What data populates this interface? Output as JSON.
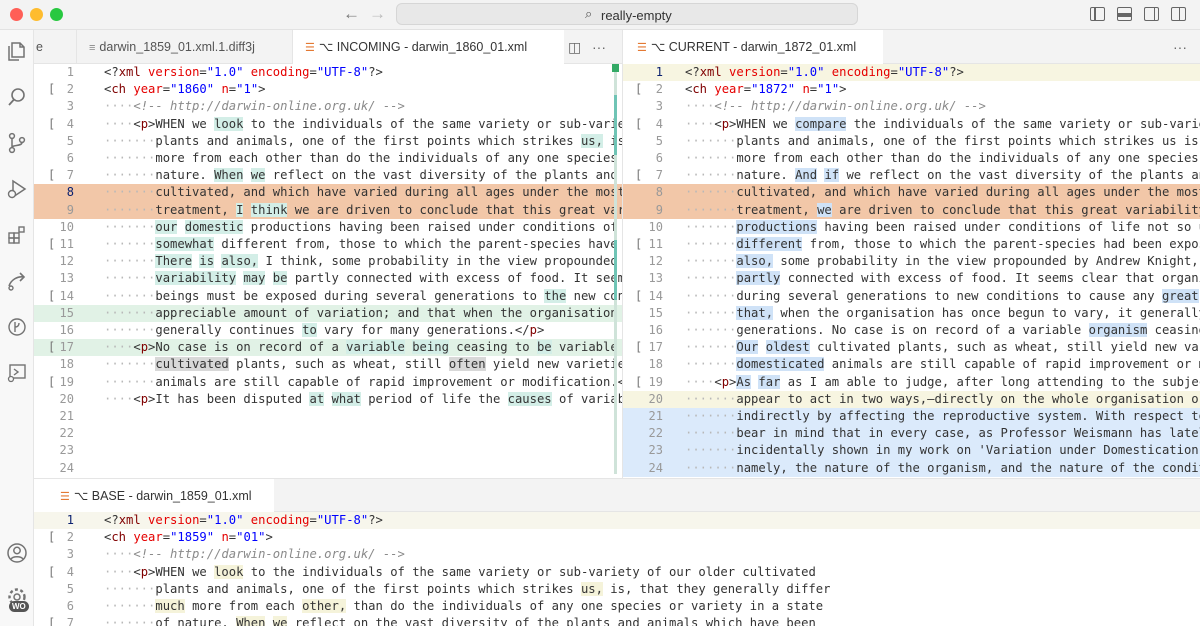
{
  "window": {
    "command_center": "really-empty",
    "colors": {
      "red": "#ff5f57",
      "yellow": "#febc2e",
      "green": "#28c840"
    }
  },
  "activity_bar": {
    "icons": [
      "explorer-icon",
      "search-icon",
      "source-control-icon",
      "run-debug-icon",
      "extensions-icon",
      "remote-icon",
      "git-graph-icon",
      "remote-explorer-icon",
      "account-icon",
      "settings-gear-icon"
    ],
    "badge": "WO"
  },
  "tabs": {
    "left_group": [
      {
        "label": "e"
      },
      {
        "label": "darwin_1859_01.xml.1.diff3j"
      },
      {
        "label": "⌥ INCOMING - darwin_1860_01.xml"
      }
    ],
    "right_group": [
      {
        "label": "⌥ CURRENT - darwin_1872_01.xml"
      }
    ],
    "bottom_group": [
      {
        "label": "⌥ BASE - darwin_1859_01.xml"
      }
    ],
    "actions": {
      "split": "◫",
      "more": "···"
    }
  },
  "editors": {
    "incoming": {
      "lines": [
        "<?xml version=\"1.0\" encoding=\"UTF-8\"?>",
        "<ch year=\"1860\" n=\"1\">",
        "····<!-- http://darwin-online.org.uk/ -->",
        "····<p>WHEN we look to the individuals of the same variety or sub-variety o",
        "·······plants and animals, one of the first points which strikes us, is, t",
        "·······more from each other than do the individuals of any one species or",
        "·······nature. When we reflect on the vast diversity of the plants and ani",
        "·······cultivated, and which have varied during all ages under the most di",
        "·······treatment, I think we are driven to conclude that this great variab",
        "·······our domestic productions having been raised under conditions of lif",
        "·······somewhat different from, those to which the parent-species have bee",
        "·······There is also, I think, some probability in the view propounded by",
        "·······variability may be partly connected with excess of food. It seems p",
        "·······beings must be exposed during several generations to the new condit",
        "·······appreciable amount of variation; and that when the organisation has",
        "·······generally continues to vary for many generations.</p>",
        "····<p>No case is on record of a variable being ceasing to be variable unde",
        "·······cultivated plants, such as wheat, still often yield new varieties:",
        "·······animals are still capable of rapid improvement or modification.</p>",
        "····<p>It has been disputed at what period of life the causes of variabilit",
        "",
        "",
        "",
        ""
      ]
    },
    "current": {
      "lines": [
        "<?xml version=\"1.0\" encoding=\"UTF-8\"?>",
        "<ch year=\"1872\" n=\"1\">",
        "····<!-- http://darwin-online.org.uk/ -->",
        "····<p>WHEN we compare the individuals of the same variety or sub-variety",
        "·······plants and animals, one of the first points which strikes us is, t",
        "·······more from each other than do the individuals of any one species or",
        "·······nature. And if we reflect on the vast diversity of the plants and",
        "·······cultivated, and which have varied during all ages under the most d",
        "·······treatment, we are driven to conclude that this great variability i",
        "·······productions having been raised under conditions of life not so uni",
        "·······different from, those to which the parent-species had been exposed",
        "·······also, some probability in the view propounded by Andrew Knight, th",
        "·······partly connected with excess of food. It seems clear that organic",
        "·······during several generations to new conditions to cause any great am",
        "·······that, when the organisation has once begun to vary, it generally c",
        "·······generations. No case is on record of a variable organism ceasing t",
        "·······Our oldest cultivated plants, such as wheat, still yield new varie",
        "·······domesticated animals are still capable of rapid improvement or mod",
        "····<p>As far as I am able to judge, after long attending to the subject,",
        "·······appear to act in two ways,—directly on the whole organisation or",
        "·······indirectly by affecting the reproductive system. With respect to t",
        "·······bear in mind that in every case, as Professor Weismann has lately",
        "·······incidentally shown in my work on 'Variation under Domestication,'",
        "·······namely, the nature of the organism, and the nature of the conditio"
      ]
    },
    "base": {
      "lines": [
        "<?xml version=\"1.0\" encoding=\"UTF-8\"?>",
        "<ch year=\"1859\" n=\"01\">",
        "····<!-- http://darwin-online.org.uk/ -->",
        "····<p>WHEN we look to the individuals of the same variety or sub-variety of our older cultivated",
        "·······plants and animals, one of the first points which strikes us, is, that they generally differ",
        "·······much more from each other, than do the individuals of any one species or variety in a state",
        "·······of nature. When we reflect on the vast diversity of the plants and animals which have been"
      ]
    }
  }
}
